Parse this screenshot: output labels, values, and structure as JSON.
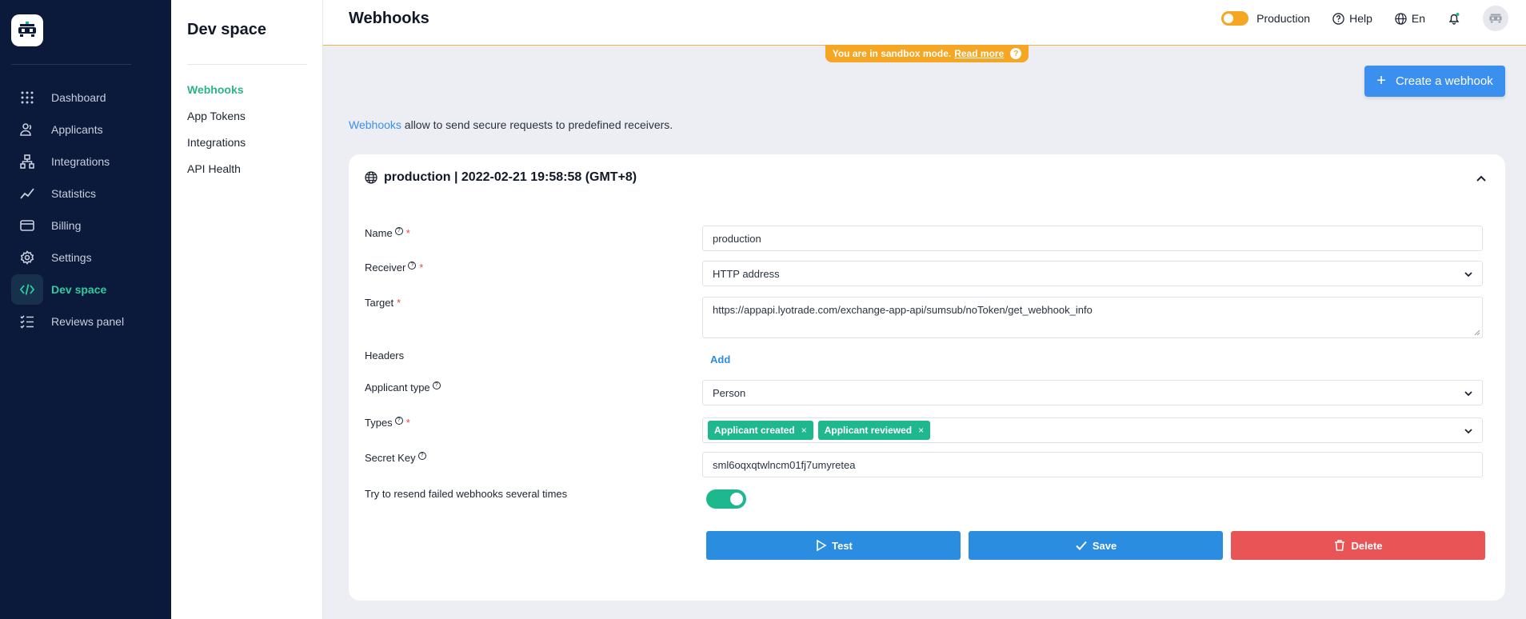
{
  "app": {
    "section_title": "Dev space",
    "page_title": "Webhooks"
  },
  "nav": {
    "items": [
      {
        "label": "Dashboard",
        "icon": "grid-dots-icon"
      },
      {
        "label": "Applicants",
        "icon": "users-icon"
      },
      {
        "label": "Integrations",
        "icon": "hierarchy-icon"
      },
      {
        "label": "Statistics",
        "icon": "trend-line-icon"
      },
      {
        "label": "Billing",
        "icon": "credit-card-icon"
      },
      {
        "label": "Settings",
        "icon": "gear-icon"
      },
      {
        "label": "Dev space",
        "icon": "code-icon",
        "active": true
      },
      {
        "label": "Reviews panel",
        "icon": "checklist-icon"
      }
    ]
  },
  "subnav": {
    "items": [
      {
        "label": "Webhooks",
        "active": true
      },
      {
        "label": "App Tokens"
      },
      {
        "label": "Integrations"
      },
      {
        "label": "API Health"
      }
    ]
  },
  "topbar": {
    "mode_label": "Production",
    "help_label": "Help",
    "lang_label": "En"
  },
  "banner": {
    "text": "You are in sandbox mode.",
    "link": "Read more",
    "q": "?"
  },
  "actions": {
    "create_label": "Create a webhook",
    "create_plus": "+"
  },
  "intro": {
    "link": "Webhooks",
    "text": " allow to send secure requests to predefined receivers."
  },
  "webhook": {
    "header": "production | 2022-02-21 19:58:58 (GMT+8)",
    "labels": {
      "name": "Name",
      "receiver": "Receiver",
      "target": "Target",
      "headers": "Headers",
      "applicant_type": "Applicant type",
      "types": "Types",
      "secret_key": "Secret Key",
      "resend": "Try to resend failed webhooks several times"
    },
    "required_mark": "*",
    "help_mark": "?",
    "values": {
      "name": "production",
      "receiver": "HTTP address",
      "target": "https://appapi.lyotrade.com/exchange-app-api/sumsub/noToken/get_webhook_info",
      "applicant_type": "Person",
      "secret_key": "sml6oqxqtwlncm01fj7umyretea"
    },
    "headers_add": "Add",
    "types_tags": [
      "Applicant created",
      "Applicant reviewed"
    ],
    "tag_remove": "×",
    "resend_enabled": true,
    "buttons": {
      "test": "Test",
      "save": "Save",
      "delete": "Delete"
    }
  },
  "colors": {
    "nav_bg": "#0b1a3b",
    "accent_green": "#1fb78e",
    "primary_blue": "#2a8de0",
    "danger_red": "#e95556",
    "sandbox_orange": "#f5a623"
  }
}
